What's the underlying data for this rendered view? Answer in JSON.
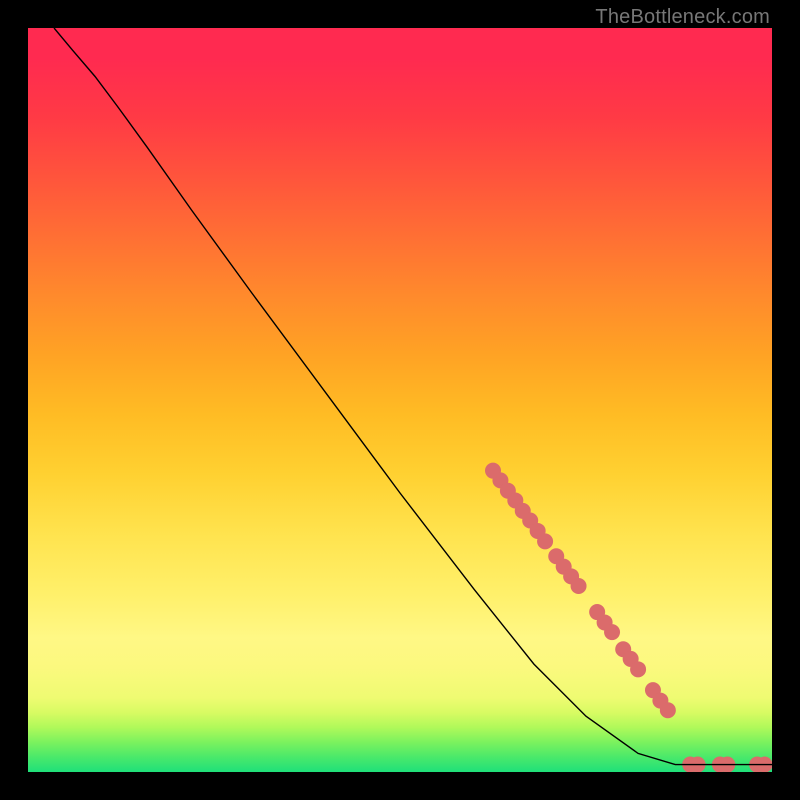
{
  "watermark": "TheBottleneck.com",
  "chart_data": {
    "type": "line",
    "title": "",
    "xlabel": "",
    "ylabel": "",
    "xlim": [
      0,
      100
    ],
    "ylim": [
      0,
      100
    ],
    "grid": false,
    "legend": false,
    "background_bands": [
      {
        "y": 0,
        "color": "#1fe07a"
      },
      {
        "y": 2,
        "color": "#4ae96a"
      },
      {
        "y": 4,
        "color": "#7bf25e"
      },
      {
        "y": 6,
        "color": "#b0f95a"
      },
      {
        "y": 8,
        "color": "#d8fb63"
      },
      {
        "y": 10,
        "color": "#effb72"
      },
      {
        "y": 14,
        "color": "#fbf97e"
      },
      {
        "y": 18,
        "color": "#fff885"
      },
      {
        "y": 24,
        "color": "#fff06a"
      },
      {
        "y": 32,
        "color": "#ffe34e"
      },
      {
        "y": 40,
        "color": "#ffd131"
      },
      {
        "y": 48,
        "color": "#ffbc24"
      },
      {
        "y": 56,
        "color": "#ffa324"
      },
      {
        "y": 64,
        "color": "#ff8a2c"
      },
      {
        "y": 72,
        "color": "#ff6f34"
      },
      {
        "y": 80,
        "color": "#ff543c"
      },
      {
        "y": 88,
        "color": "#ff3a45"
      },
      {
        "y": 96,
        "color": "#ff2a50"
      }
    ],
    "series": [
      {
        "name": "curve",
        "stroke": "#000000",
        "stroke_width": 1.4,
        "points": [
          {
            "x": 3.5,
            "y": 100.0
          },
          {
            "x": 6.0,
            "y": 97.0
          },
          {
            "x": 9.0,
            "y": 93.5
          },
          {
            "x": 12.0,
            "y": 89.5
          },
          {
            "x": 16.0,
            "y": 84.0
          },
          {
            "x": 22.0,
            "y": 75.5
          },
          {
            "x": 30.0,
            "y": 64.5
          },
          {
            "x": 40.0,
            "y": 51.0
          },
          {
            "x": 50.0,
            "y": 37.5
          },
          {
            "x": 60.0,
            "y": 24.5
          },
          {
            "x": 68.0,
            "y": 14.5
          },
          {
            "x": 75.0,
            "y": 7.5
          },
          {
            "x": 82.0,
            "y": 2.5
          },
          {
            "x": 87.0,
            "y": 1.0
          },
          {
            "x": 92.0,
            "y": 1.0
          },
          {
            "x": 97.0,
            "y": 1.0
          },
          {
            "x": 100.0,
            "y": 1.0
          }
        ]
      }
    ],
    "markers": {
      "color": "#db6b6b",
      "radius": 8,
      "points": [
        {
          "x": 62.5,
          "y": 40.5
        },
        {
          "x": 63.5,
          "y": 39.2
        },
        {
          "x": 64.5,
          "y": 37.8
        },
        {
          "x": 65.5,
          "y": 36.5
        },
        {
          "x": 66.5,
          "y": 35.1
        },
        {
          "x": 67.5,
          "y": 33.8
        },
        {
          "x": 68.5,
          "y": 32.4
        },
        {
          "x": 69.5,
          "y": 31.0
        },
        {
          "x": 71.0,
          "y": 29.0
        },
        {
          "x": 72.0,
          "y": 27.6
        },
        {
          "x": 73.0,
          "y": 26.3
        },
        {
          "x": 74.0,
          "y": 25.0
        },
        {
          "x": 76.5,
          "y": 21.5
        },
        {
          "x": 77.5,
          "y": 20.1
        },
        {
          "x": 78.5,
          "y": 18.8
        },
        {
          "x": 80.0,
          "y": 16.5
        },
        {
          "x": 81.0,
          "y": 15.2
        },
        {
          "x": 82.0,
          "y": 13.8
        },
        {
          "x": 84.0,
          "y": 11.0
        },
        {
          "x": 85.0,
          "y": 9.6
        },
        {
          "x": 86.0,
          "y": 8.3
        },
        {
          "x": 89.0,
          "y": 1.0
        },
        {
          "x": 90.0,
          "y": 1.0
        },
        {
          "x": 93.0,
          "y": 1.0
        },
        {
          "x": 94.0,
          "y": 1.0
        },
        {
          "x": 98.0,
          "y": 1.0
        },
        {
          "x": 99.0,
          "y": 1.0
        }
      ]
    }
  }
}
